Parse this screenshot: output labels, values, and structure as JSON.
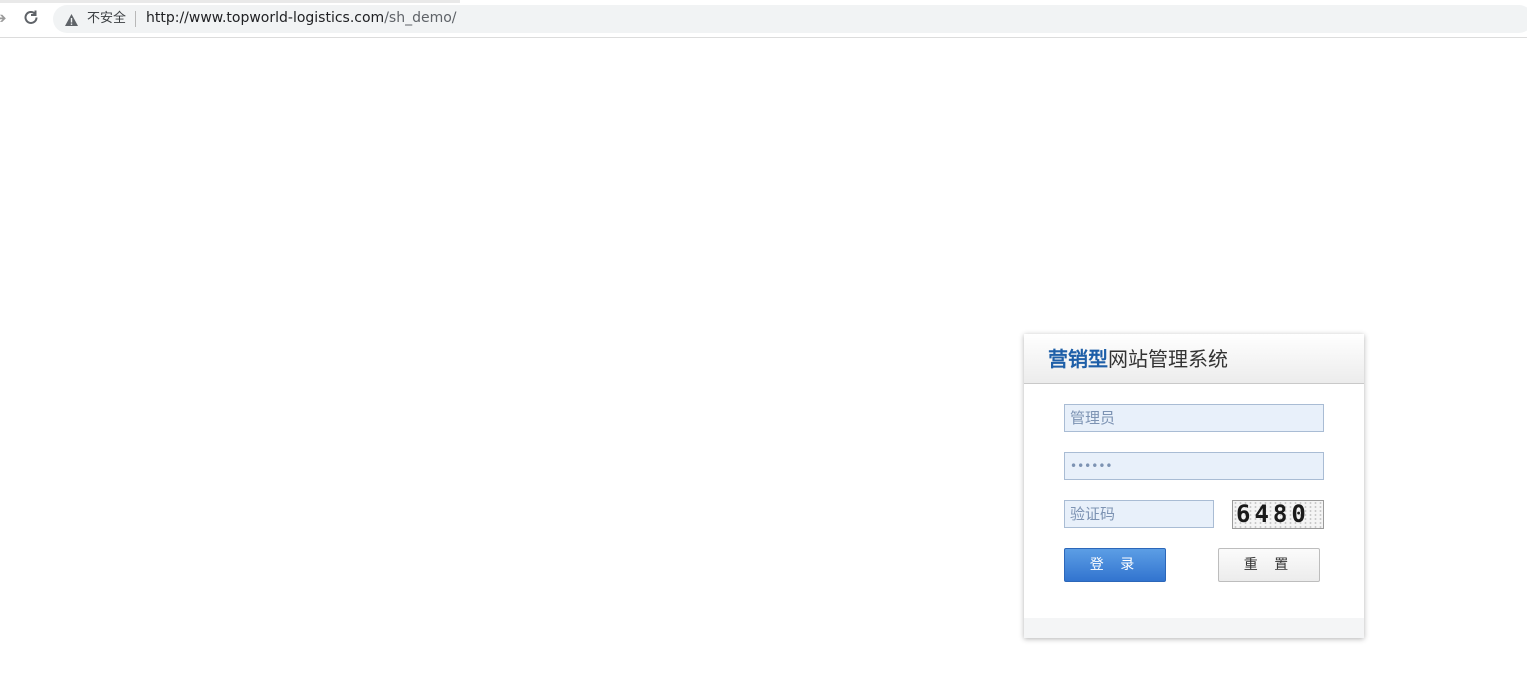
{
  "browser": {
    "security_label": "不安全",
    "url_host": "http://www.topworld-logistics.com",
    "url_path": "/sh_demo/",
    "icons": {
      "forward": "forward-arrow-icon",
      "reload": "reload-icon",
      "warning": "warning-icon"
    }
  },
  "login": {
    "title_brand": "营销型",
    "title_rest": "网站管理系统",
    "username_value": "管理员",
    "password_value": "••••••",
    "captcha_placeholder": "验证码",
    "captcha_code": "6480",
    "login_label": "登 录",
    "reset_label": "重 置",
    "colors": {
      "brand": "#1e5fa8",
      "login_button": "#3274cf",
      "field_background": "#e8f0fa"
    }
  }
}
